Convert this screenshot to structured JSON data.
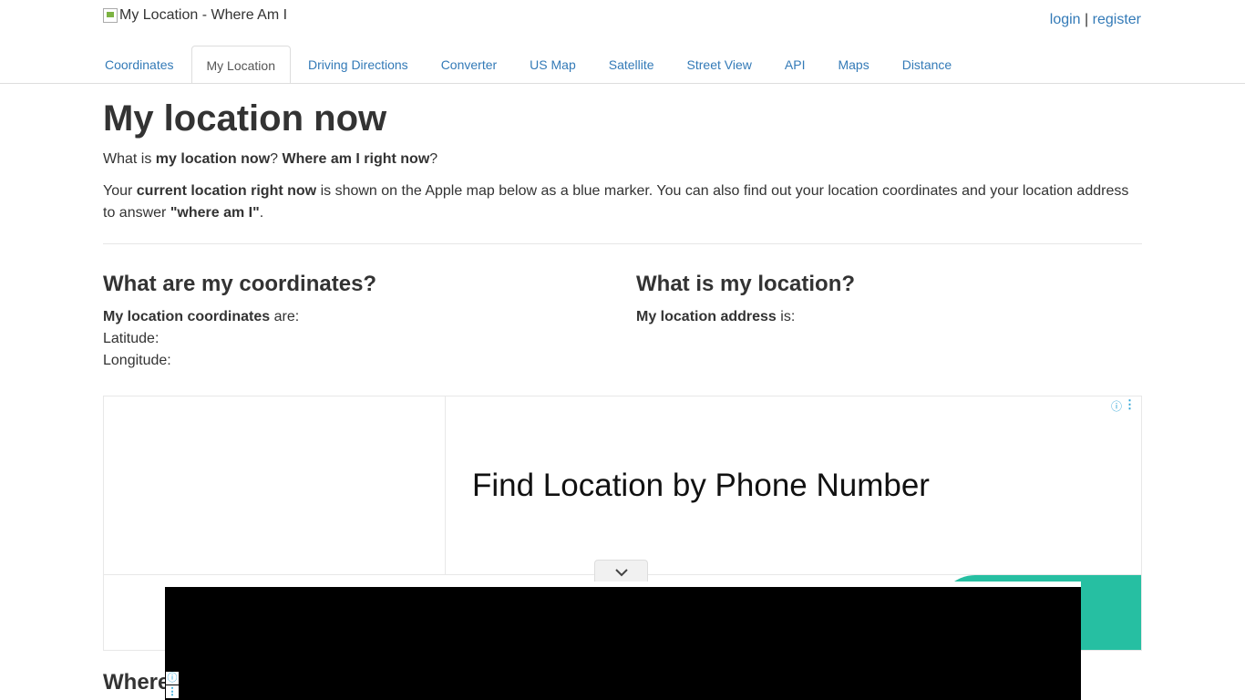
{
  "header": {
    "logo_alt": "My Location - Where Am I",
    "login": "login",
    "separator": "|",
    "register": "register"
  },
  "nav": {
    "items": [
      {
        "label": "Coordinates"
      },
      {
        "label": "My Location",
        "active": true
      },
      {
        "label": "Driving Directions"
      },
      {
        "label": "Converter"
      },
      {
        "label": "US Map"
      },
      {
        "label": "Satellite"
      },
      {
        "label": "Street View"
      },
      {
        "label": "API"
      },
      {
        "label": "Maps"
      },
      {
        "label": "Distance"
      }
    ]
  },
  "main": {
    "title": "My location now",
    "intro": {
      "t1": "What is ",
      "b1": "my location now",
      "t2": "? ",
      "b2": "Where am I right now",
      "t3": "?"
    },
    "desc": {
      "t1": "Your ",
      "b1": "current location right now",
      "t2": " is shown on the Apple map below as a blue marker. You can also find out your location coordinates and your location address to answer ",
      "b2": "\"where am I\"",
      "t3": "."
    },
    "coords": {
      "heading": "What are my coordinates?",
      "label_bold": "My location coordinates",
      "label_rest": " are:",
      "latitude": "Latitude:",
      "longitude": "Longitude:"
    },
    "location": {
      "heading": "What is my location?",
      "label_bold": "My location address",
      "label_rest": " is:"
    },
    "next_heading_partial": "Where"
  },
  "ad": {
    "headline": "Find Location by Phone Number",
    "info_icon": "ⓘ",
    "menu_icon": "⋮"
  },
  "overlay": {
    "info_icon": "ⓘ",
    "menu_icon": "⋮"
  },
  "colors": {
    "link": "#337ab7",
    "cta": "#26bfa2"
  }
}
